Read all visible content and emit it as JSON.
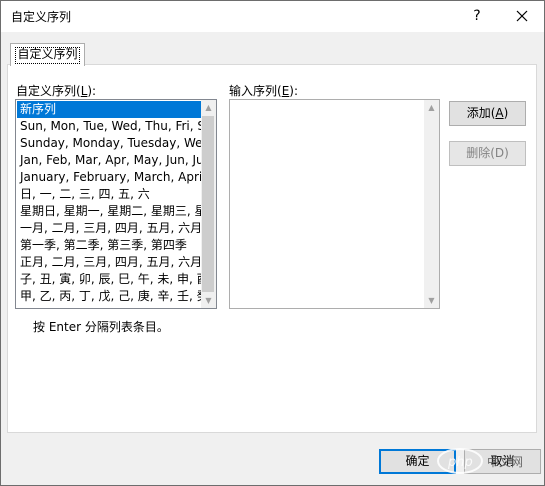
{
  "window": {
    "title": "自定义序列",
    "help_icon": "question-mark-icon",
    "close_icon": "close-icon"
  },
  "tabs": [
    {
      "label": "自定义序列"
    }
  ],
  "left_list": {
    "label_prefix": "自定义序列(",
    "label_accel": "L",
    "label_suffix": "):",
    "items": [
      "新序列",
      "Sun, Mon, Tue, Wed, Thu, Fri, Sat",
      "Sunday, Monday, Tuesday, Wednesday",
      "Jan, Feb, Mar, Apr, May, Jun, Jul",
      "January, February, March, April",
      "日, 一, 二, 三, 四, 五, 六",
      "星期日, 星期一, 星期二, 星期三, 星期四",
      "一月, 二月, 三月, 四月, 五月, 六月",
      "第一季, 第二季, 第三季, 第四季",
      "正月, 二月, 三月, 四月, 五月, 六月",
      "子, 丑, 寅, 卯, 辰, 巳, 午, 未, 申, 酉",
      "甲, 乙, 丙, 丁, 戊, 己, 庚, 辛, 壬, 癸"
    ],
    "selected_index": 0
  },
  "entry": {
    "label_prefix": "输入序列(",
    "label_accel": "E",
    "label_suffix": "):",
    "value": ""
  },
  "buttons": {
    "add_prefix": "添加(",
    "add_accel": "A",
    "add_suffix": ")",
    "delete": "删除(D)",
    "ok": "确定",
    "cancel": "取消"
  },
  "hint": "按 Enter 分隔列表条目。",
  "watermark": {
    "brand": "php",
    "site": "中文网"
  },
  "colors": {
    "selection": "#0078d7",
    "default_button_border": "#0078d7"
  }
}
